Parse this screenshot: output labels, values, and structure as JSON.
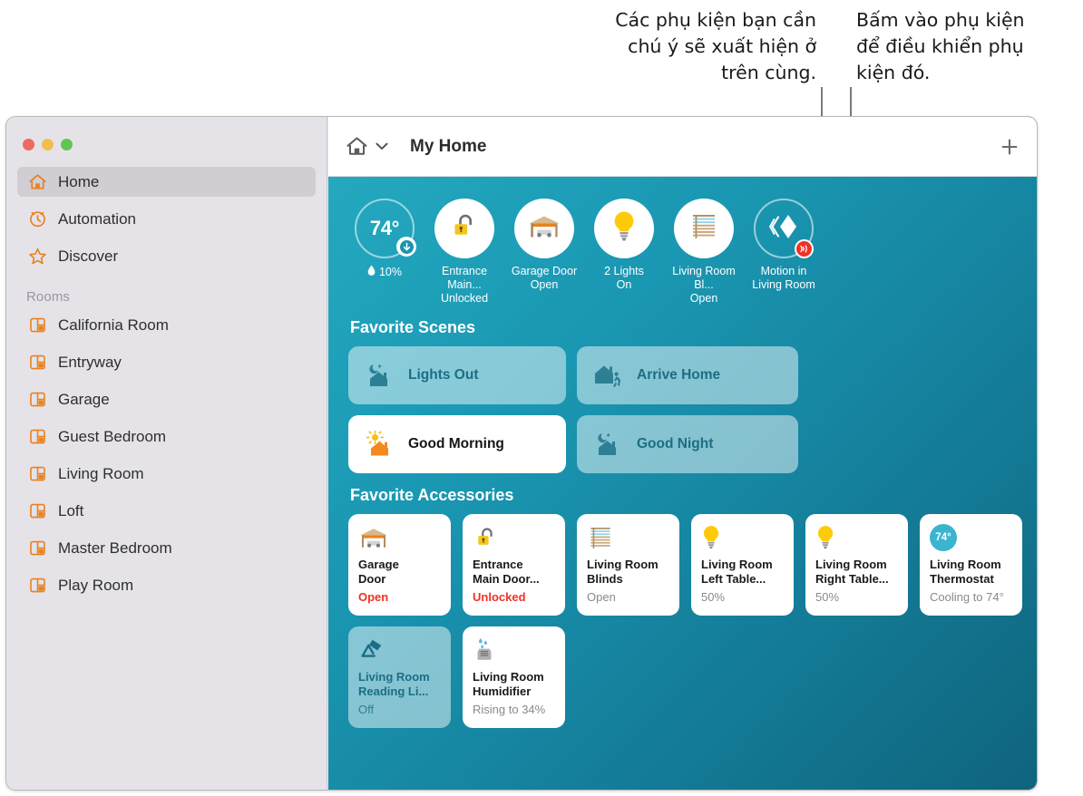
{
  "annotations": {
    "left": "Các phụ kiện bạn cần\nchú ý sẽ xuất hiện ở\ntrên cùng.",
    "right": "Bấm vào phụ kiện\nđể điều khiển phụ\nkiện đó."
  },
  "window": {
    "traffic_lights": [
      "close",
      "minimize",
      "maximize"
    ]
  },
  "sidebar": {
    "items": [
      {
        "label": "Home",
        "icon": "home-icon",
        "selected": true
      },
      {
        "label": "Automation",
        "icon": "automation-clock-icon",
        "selected": false
      },
      {
        "label": "Discover",
        "icon": "star-icon",
        "selected": false
      }
    ],
    "rooms_header": "Rooms",
    "rooms": [
      {
        "label": "California Room",
        "icon": "room-icon"
      },
      {
        "label": "Entryway",
        "icon": "room-icon"
      },
      {
        "label": "Garage",
        "icon": "room-icon"
      },
      {
        "label": "Guest Bedroom",
        "icon": "room-icon"
      },
      {
        "label": "Living Room",
        "icon": "room-icon"
      },
      {
        "label": "Loft",
        "icon": "room-icon"
      },
      {
        "label": "Master Bedroom",
        "icon": "room-icon"
      },
      {
        "label": "Play Room",
        "icon": "room-icon"
      }
    ]
  },
  "toolbar": {
    "home_icon": "home-icon",
    "chevron_icon": "chevron-down-icon",
    "title": "My Home",
    "add_icon": "plus-icon"
  },
  "status_strip": [
    {
      "kind": "temperature",
      "value": "74°",
      "humidity": "10%",
      "humidity_icon": "droplet-icon",
      "badge": "download-arrow-icon",
      "label": ""
    },
    {
      "kind": "accessory",
      "icon": "unlocked-padlock-icon",
      "label": "Entrance Main...\nUnlocked"
    },
    {
      "kind": "accessory",
      "icon": "garage-door-icon",
      "label": "Garage Door\nOpen"
    },
    {
      "kind": "accessory",
      "icon": "lightbulb-icon",
      "label": "2 Lights\nOn"
    },
    {
      "kind": "accessory",
      "icon": "blinds-icon",
      "label": "Living Room Bl...\nOpen"
    },
    {
      "kind": "sensor",
      "icon": "motion-sensor-icon",
      "badge": "motion-wave-icon",
      "label": "Motion in\nLiving Room"
    }
  ],
  "scenes_section": {
    "title": "Favorite Scenes",
    "items": [
      {
        "label": "Lights Out",
        "icon": "moon-house-icon",
        "active": false
      },
      {
        "label": "Arrive Home",
        "icon": "house-walk-icon",
        "active": false
      },
      {
        "label": "Good Morning",
        "icon": "sun-house-icon",
        "active": true
      },
      {
        "label": "Good Night",
        "icon": "moon-house-icon",
        "active": false
      }
    ]
  },
  "accessories_section": {
    "title": "Favorite Accessories",
    "items": [
      {
        "name": "Garage\nDoor",
        "state": "Open",
        "icon": "garage-door-icon",
        "state_style": "red",
        "off": false
      },
      {
        "name": "Entrance\nMain Door...",
        "state": "Unlocked",
        "icon": "unlocked-padlock-icon",
        "state_style": "red",
        "off": false
      },
      {
        "name": "Living Room\nBlinds",
        "state": "Open",
        "icon": "blinds-icon",
        "state_style": "normal",
        "off": false
      },
      {
        "name": "Living Room\nLeft Table...",
        "state": "50%",
        "icon": "lightbulb-icon",
        "state_style": "normal",
        "off": false
      },
      {
        "name": "Living Room\nRight Table...",
        "state": "50%",
        "icon": "lightbulb-icon",
        "state_style": "normal",
        "off": false
      },
      {
        "name": "Living Room\nThermostat",
        "state": "Cooling to 74°",
        "icon": "thermostat-pill-icon",
        "state_style": "normal",
        "off": false,
        "pill_value": "74°"
      },
      {
        "name": "Living Room\nReading Li...",
        "state": "Off",
        "icon": "desk-lamp-icon",
        "state_style": "normal",
        "off": true
      },
      {
        "name": "Living Room\nHumidifier",
        "state": "Rising to 34%",
        "icon": "humidifier-icon",
        "state_style": "normal",
        "off": false
      }
    ]
  },
  "colors": {
    "accent_orange": "#e8821e",
    "background_teal_light": "#25abc2",
    "background_teal_dark": "#0f647c",
    "status_red": "#f03226",
    "scene_text": "#1b6e84",
    "leader_line": "#7a7a7a"
  }
}
